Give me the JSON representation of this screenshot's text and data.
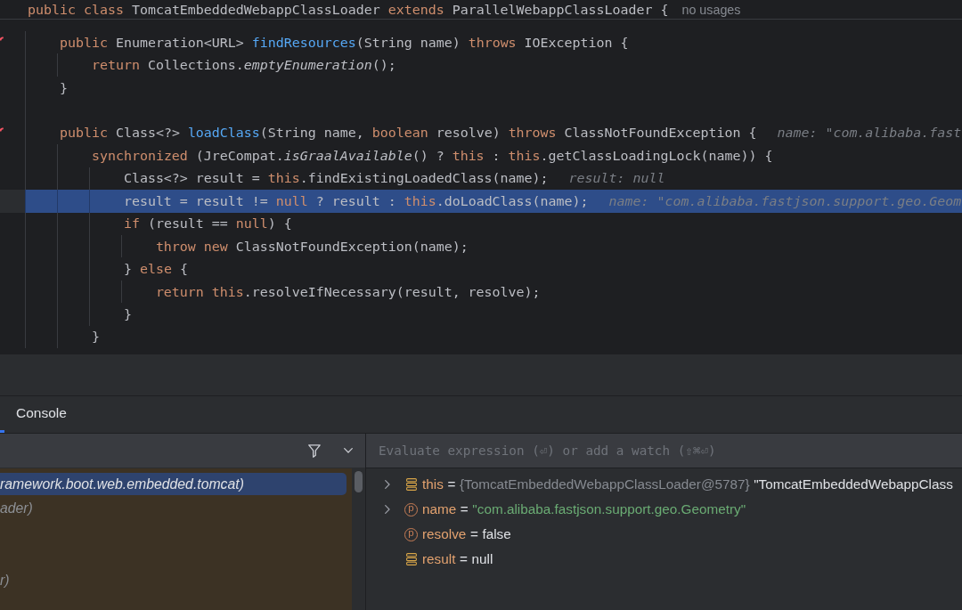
{
  "editor": {
    "sticky_header": {
      "tokens": [
        {
          "kind": "keyword",
          "text": "public class"
        },
        {
          "kind": "plain",
          "text": " TomcatEmbeddedWebappClassLoader "
        },
        {
          "kind": "keyword",
          "text": "extends"
        },
        {
          "kind": "plain",
          "text": " ParallelWebappClassLoader {"
        }
      ],
      "usages_hint": "no usages"
    },
    "lines": [
      {
        "marker": true,
        "selected": false,
        "tokens": [
          {
            "kind": "keyword",
            "text": "public"
          },
          {
            "kind": "plain",
            "text": " Enumeration<URL> "
          },
          {
            "kind": "declaration",
            "text": "findResources"
          },
          {
            "kind": "plain",
            "text": "(String name) "
          },
          {
            "kind": "keyword",
            "text": "throws"
          },
          {
            "kind": "plain",
            "text": " IOException {"
          }
        ],
        "children": [
          {
            "marker": false,
            "selected": false,
            "tokens": [
              {
                "kind": "keyword",
                "text": "return"
              },
              {
                "kind": "plain",
                "text": " Collections."
              },
              {
                "kind": "static_call",
                "text": "emptyEnumeration"
              },
              {
                "kind": "plain",
                "text": "();"
              }
            ]
          }
        ]
      },
      {
        "marker": false,
        "selected": false,
        "tokens": [
          {
            "kind": "plain",
            "text": "}"
          }
        ]
      },
      {
        "marker": false,
        "selected": false
      },
      {
        "marker": true,
        "selected": false,
        "tokens": [
          {
            "kind": "keyword",
            "text": "public"
          },
          {
            "kind": "plain",
            "text": " Class<?> "
          },
          {
            "kind": "declaration",
            "text": "loadClass"
          },
          {
            "kind": "plain",
            "text": "(String name, "
          },
          {
            "kind": "keyword",
            "text": "boolean"
          },
          {
            "kind": "plain",
            "text": " resolve) "
          },
          {
            "kind": "keyword",
            "text": "throws"
          },
          {
            "kind": "plain",
            "text": " ClassNotFoundException {"
          }
        ],
        "hint": "name: \"com.alibaba.fast",
        "children": [
          {
            "marker": false,
            "selected": false,
            "tokens": [
              {
                "kind": "keyword",
                "text": "synchronized"
              },
              {
                "kind": "plain",
                "text": " (JreCompat."
              },
              {
                "kind": "static_call",
                "text": "isGraalAvailable"
              },
              {
                "kind": "plain",
                "text": "() ? "
              },
              {
                "kind": "keyword",
                "text": "this"
              },
              {
                "kind": "plain",
                "text": " : "
              },
              {
                "kind": "keyword",
                "text": "this"
              },
              {
                "kind": "plain",
                "text": ".getClassLoadingLock(name)) {"
              }
            ],
            "children": [
              {
                "marker": false,
                "selected": false,
                "tokens": [
                  {
                    "kind": "plain",
                    "text": "Class<?> result = "
                  },
                  {
                    "kind": "keyword",
                    "text": "this"
                  },
                  {
                    "kind": "plain",
                    "text": ".findExistingLoadedClass(name);"
                  }
                ],
                "hint": "result: null"
              },
              {
                "marker": false,
                "selected": true,
                "tokens": [
                  {
                    "kind": "plain",
                    "text": "result = result != "
                  },
                  {
                    "kind": "keyword",
                    "text": "null"
                  },
                  {
                    "kind": "plain",
                    "text": " ? result : "
                  },
                  {
                    "kind": "keyword",
                    "text": "this"
                  },
                  {
                    "kind": "plain",
                    "text": ".doLoadClass(name);"
                  }
                ],
                "hint": "name: \"com.alibaba.fastjson.support.geo.Geom"
              },
              {
                "marker": false,
                "selected": false,
                "tokens": [
                  {
                    "kind": "keyword",
                    "text": "if"
                  },
                  {
                    "kind": "plain",
                    "text": " (result == "
                  },
                  {
                    "kind": "keyword",
                    "text": "null"
                  },
                  {
                    "kind": "plain",
                    "text": ") {"
                  }
                ],
                "children": [
                  {
                    "marker": false,
                    "selected": false,
                    "tokens": [
                      {
                        "kind": "keyword",
                        "text": "throw new"
                      },
                      {
                        "kind": "plain",
                        "text": " ClassNotFoundException(name);"
                      }
                    ]
                  }
                ]
              },
              {
                "marker": false,
                "selected": false,
                "tokens": [
                  {
                    "kind": "plain",
                    "text": "} "
                  },
                  {
                    "kind": "keyword",
                    "text": "else"
                  },
                  {
                    "kind": "plain",
                    "text": " {"
                  }
                ],
                "children": [
                  {
                    "marker": false,
                    "selected": false,
                    "tokens": [
                      {
                        "kind": "keyword",
                        "text": "return this"
                      },
                      {
                        "kind": "plain",
                        "text": ".resolveIfNecessary(result, resolve);"
                      }
                    ]
                  }
                ]
              },
              {
                "marker": false,
                "selected": false,
                "tokens": [
                  {
                    "kind": "plain",
                    "text": "}"
                  }
                ]
              }
            ]
          },
          {
            "marker": false,
            "selected": false,
            "tokens": [
              {
                "kind": "plain",
                "text": "}"
              }
            ]
          }
        ]
      }
    ]
  },
  "tool_window": {
    "tabs": [
      {
        "selected": true
      },
      {
        "label": "Console",
        "selected": false
      }
    ]
  },
  "frames": {
    "rows": [
      {
        "text": "ramework.boot.web.embedded.tomcat)",
        "selected": true
      },
      {
        "text": "ader)",
        "selected": false
      },
      {
        "selected": false
      },
      {
        "selected": false
      },
      {
        "text": "r)",
        "selected": false
      }
    ]
  },
  "variables": {
    "evaluate_field": {
      "placeholder": "Evaluate expression (⏎) or add a watch (⇧⌘⏎)"
    },
    "items": [
      {
        "kind": "field",
        "expandable": true,
        "name": "this",
        "separator": "=",
        "type_label": "{TomcatEmbeddedWebappClassLoader@5787}",
        "value": {
          "kind": "object",
          "text": "\"TomcatEmbeddedWebappClass"
        }
      },
      {
        "kind": "parameter",
        "badge": "p",
        "expandable": true,
        "name": "name",
        "separator": "=",
        "value": {
          "kind": "string",
          "text": "\"com.alibaba.fastjson.support.geo.Geometry\""
        }
      },
      {
        "kind": "parameter",
        "badge": "p",
        "expandable": false,
        "name": "resolve",
        "separator": "=",
        "value": {
          "kind": "literal",
          "text": "false"
        }
      },
      {
        "kind": "field",
        "expandable": false,
        "name": "result",
        "separator": "=",
        "value": {
          "kind": "literal",
          "text": "null"
        }
      }
    ]
  }
}
